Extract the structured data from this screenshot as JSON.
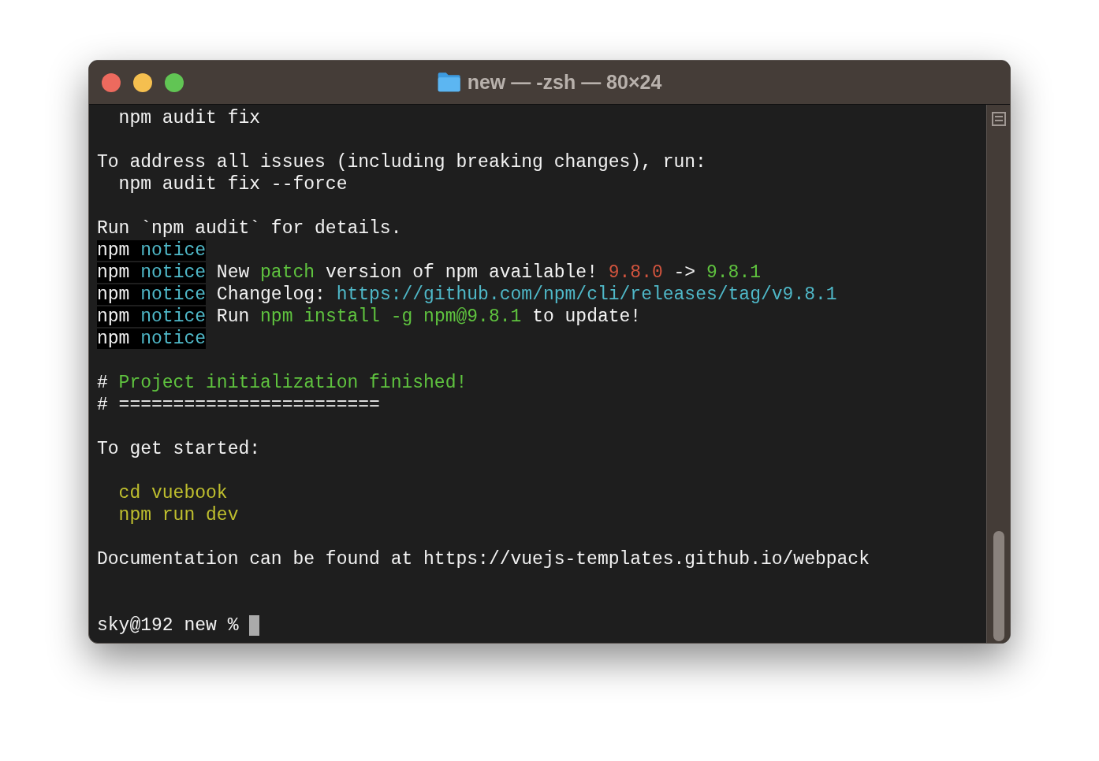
{
  "window": {
    "title": "new — -zsh — 80×24"
  },
  "terminal": {
    "lines": [
      {
        "kind": "text",
        "segments": [
          {
            "kind": "plain",
            "text": "  npm audit fix"
          }
        ]
      },
      {
        "kind": "blank"
      },
      {
        "kind": "text",
        "segments": [
          {
            "kind": "plain",
            "text": "To address all issues (including breaking changes), run:"
          }
        ]
      },
      {
        "kind": "text",
        "segments": [
          {
            "kind": "plain",
            "text": "  npm audit fix --force"
          }
        ]
      },
      {
        "kind": "blank"
      },
      {
        "kind": "text",
        "segments": [
          {
            "kind": "plain",
            "text": "Run `npm audit` for details."
          }
        ]
      },
      {
        "kind": "text",
        "segments": [
          {
            "kind": "boxed",
            "text": "npm "
          },
          {
            "kind": "boxed-cyan",
            "text": "notice"
          }
        ]
      },
      {
        "kind": "text",
        "segments": [
          {
            "kind": "boxed",
            "text": "npm "
          },
          {
            "kind": "boxed-cyan",
            "text": "notice"
          },
          {
            "kind": "plain",
            "text": " New "
          },
          {
            "kind": "green",
            "text": "patch"
          },
          {
            "kind": "plain",
            "text": " version of npm available! "
          },
          {
            "kind": "red",
            "text": "9.8.0"
          },
          {
            "kind": "plain",
            "text": " -> "
          },
          {
            "kind": "green",
            "text": "9.8.1"
          }
        ]
      },
      {
        "kind": "text",
        "segments": [
          {
            "kind": "boxed",
            "text": "npm "
          },
          {
            "kind": "boxed-cyan",
            "text": "notice"
          },
          {
            "kind": "plain",
            "text": " Changelog: "
          },
          {
            "kind": "cyan",
            "text": "https://github.com/npm/cli/releases/tag/v9.8.1"
          }
        ]
      },
      {
        "kind": "text",
        "segments": [
          {
            "kind": "boxed",
            "text": "npm "
          },
          {
            "kind": "boxed-cyan",
            "text": "notice"
          },
          {
            "kind": "plain",
            "text": " Run "
          },
          {
            "kind": "green",
            "text": "npm install -g npm@9.8.1"
          },
          {
            "kind": "plain",
            "text": " to update!"
          }
        ]
      },
      {
        "kind": "text",
        "segments": [
          {
            "kind": "boxed",
            "text": "npm "
          },
          {
            "kind": "boxed-cyan",
            "text": "notice"
          }
        ]
      },
      {
        "kind": "blank"
      },
      {
        "kind": "text",
        "segments": [
          {
            "kind": "plain",
            "text": "# "
          },
          {
            "kind": "green",
            "text": "Project initialization finished!"
          }
        ]
      },
      {
        "kind": "text",
        "segments": [
          {
            "kind": "plain",
            "text": "# ========================"
          }
        ]
      },
      {
        "kind": "blank"
      },
      {
        "kind": "text",
        "segments": [
          {
            "kind": "plain",
            "text": "To get started:"
          }
        ]
      },
      {
        "kind": "blank"
      },
      {
        "kind": "text",
        "segments": [
          {
            "kind": "yellow",
            "text": "  cd vuebook"
          }
        ]
      },
      {
        "kind": "text",
        "segments": [
          {
            "kind": "yellow",
            "text": "  npm run dev"
          }
        ]
      },
      {
        "kind": "blank"
      },
      {
        "kind": "text",
        "segments": [
          {
            "kind": "plain",
            "text": "Documentation can be found at https://vuejs-templates.github.io/webpack"
          }
        ]
      },
      {
        "kind": "blank"
      },
      {
        "kind": "blank"
      },
      {
        "kind": "prompt",
        "segments": [
          {
            "kind": "plain",
            "text": "sky@192 new % "
          }
        ]
      }
    ]
  }
}
